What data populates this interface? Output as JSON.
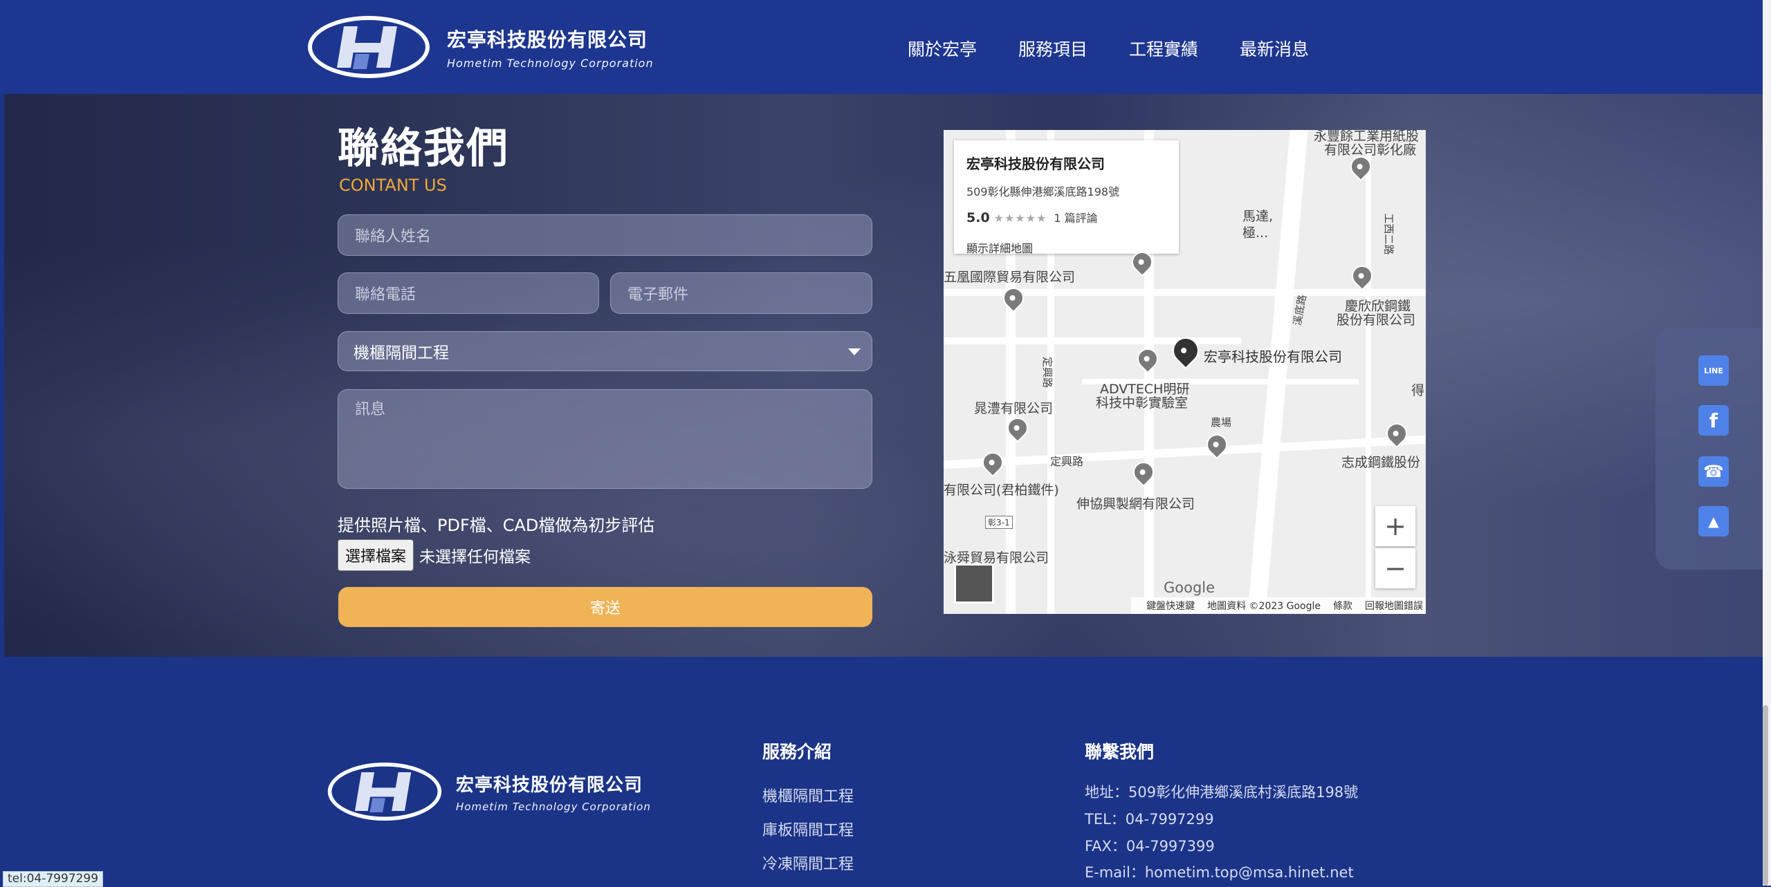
{
  "brand": {
    "name_cn": "宏亭科技股份有限公司",
    "name_en": "Hometim Technology Corporation"
  },
  "nav": {
    "items": [
      "關於宏亭",
      "服務項目",
      "工程實績",
      "最新消息"
    ]
  },
  "contact": {
    "title": "聯絡我們",
    "subtitle": "CONTANT US",
    "name_placeholder": "聯絡人姓名",
    "phone_placeholder": "聯絡電話",
    "email_placeholder": "電子郵件",
    "service_selected": "機櫃隔間工程",
    "message_placeholder": "訊息",
    "upload_hint": "提供照片檔、PDF檔、CAD檔做為初步評估",
    "file_button": "選擇檔案",
    "file_status": "未選擇任何檔案",
    "submit": "寄送"
  },
  "map": {
    "card": {
      "name": "宏亭科技股份有限公司",
      "address": "509彰化縣伸港鄉溪底路198號",
      "rating": "5.0",
      "stars": "★★★★★",
      "reviews": "1 篇評論",
      "link": "顯示詳細地圖"
    },
    "labels": {
      "main": "宏亭科技股份有限公司",
      "advtech_1": "ADVTECH明研",
      "advtech_2": "科技中彰實驗室",
      "huangchuan": "晁澧有限公司",
      "trade": "五凰國際貿易有限公司",
      "qingxin_1": "慶欣欣鋼鐵",
      "qingxin_2": "股份有限公司",
      "zhicheng": "志成鋼鐵股份",
      "junbo": "有限公司(君柏鐵件)",
      "shenxie": "伸協興製網有限公司",
      "shunyi": "泳舜貿易有限公司",
      "dingxing": "定興路",
      "farm": "農場",
      "mada_1": "馬達,",
      "mada_2": "極...",
      "top_right_1": "永豐餘工業用紙股",
      "top_right_2": "有限公司彰化廠",
      "xidi": "溪底路",
      "gongxi": "工西二路",
      "de": "得",
      "route": "彰3-1",
      "dingxing_v": "定興路"
    },
    "google": "Google",
    "footer": [
      "鍵盤快速鍵",
      "地圖資料 ©2023 Google",
      "條款",
      "回報地圖錯誤"
    ],
    "zoom_in": "+",
    "zoom_out": "−"
  },
  "float": {
    "line_label": "LINE",
    "facebook_label": "f",
    "phone_label": "☎",
    "top_label": "▲"
  },
  "footer": {
    "services_title": "服務介紹",
    "services": [
      "機櫃隔間工程",
      "庫板隔間工程",
      "冷凍隔間工程"
    ],
    "contact_title": "聯繫我們",
    "address": "地址：509彰化伸港鄉溪底村溪底路198號",
    "tel": "TEL：04-7997299",
    "fax": "FAX：04-7997399",
    "email": "E-mail：hometim.top@msa.hinet.net"
  },
  "status_tip": "tel:04-7997299",
  "colors": {
    "header_bg": "#1d3690",
    "accent": "#f0b356",
    "subtitle": "#f0a93a"
  }
}
